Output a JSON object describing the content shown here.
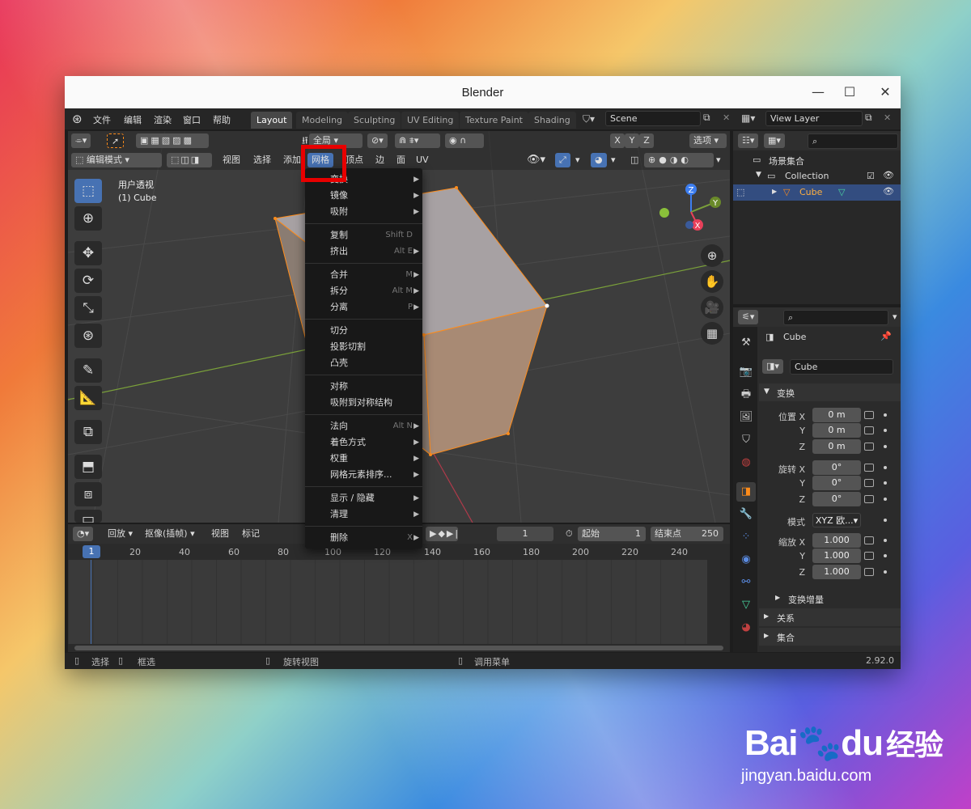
{
  "window": {
    "title": "Blender"
  },
  "topbar": {
    "menus": [
      "文件",
      "编辑",
      "渲染",
      "窗口",
      "帮助"
    ],
    "workspaces": [
      "Layout",
      "Modeling",
      "Sculpting",
      "UV Editing",
      "Texture Paint",
      "Shading"
    ],
    "scene": "Scene",
    "view_layer": "View Layer"
  },
  "viewport": {
    "transform_orient": "全局",
    "options": "选项",
    "axes": [
      "X",
      "Y",
      "Z"
    ],
    "mode": "编辑模式",
    "header_menus": {
      "view": "视图",
      "select": "选择",
      "add": "添加",
      "mesh": "网格",
      "vertex": "顶点",
      "edge": "边",
      "face": "面",
      "uv": "UV"
    },
    "overlay_title": "用户透视",
    "overlay_sub": "(1) Cube",
    "gizmo": {
      "x": "X",
      "y": "Y",
      "z": "Z"
    }
  },
  "mesh_menu": {
    "items": [
      {
        "label": "变换",
        "shortcut": "",
        "arrow": true
      },
      {
        "label": "镜像",
        "shortcut": "",
        "arrow": true
      },
      {
        "label": "吸附",
        "shortcut": "",
        "arrow": true
      },
      {
        "label": "复制",
        "shortcut": "Shift D",
        "arrow": false
      },
      {
        "label": "挤出",
        "shortcut": "Alt E",
        "arrow": true
      },
      {
        "label": "合并",
        "shortcut": "M",
        "arrow": true
      },
      {
        "label": "拆分",
        "shortcut": "Alt M",
        "arrow": true
      },
      {
        "label": "分离",
        "shortcut": "P",
        "arrow": true
      },
      {
        "label": "切分",
        "shortcut": "",
        "arrow": false
      },
      {
        "label": "投影切割",
        "shortcut": "",
        "arrow": false
      },
      {
        "label": "凸壳",
        "shortcut": "",
        "arrow": false
      },
      {
        "label": "对称",
        "shortcut": "",
        "arrow": false
      },
      {
        "label": "吸附到对称结构",
        "shortcut": "",
        "arrow": false
      },
      {
        "label": "法向",
        "shortcut": "Alt N",
        "arrow": true
      },
      {
        "label": "着色方式",
        "shortcut": "",
        "arrow": true
      },
      {
        "label": "权重",
        "shortcut": "",
        "arrow": true
      },
      {
        "label": "网格元素排序...",
        "shortcut": "",
        "arrow": true
      },
      {
        "label": "显示 / 隐藏",
        "shortcut": "",
        "arrow": true
      },
      {
        "label": "清理",
        "shortcut": "",
        "arrow": true
      },
      {
        "label": "删除",
        "shortcut": "X",
        "arrow": true
      }
    ]
  },
  "timeline": {
    "menus": {
      "playback": "回放",
      "keying": "抠像(插帧)",
      "view": "视图",
      "marker": "标记"
    },
    "current_frame": "1",
    "start_label": "起始",
    "start": "1",
    "end_label": "结束点",
    "end": "250",
    "ticks": [
      "1",
      "20",
      "40",
      "60",
      "80",
      "100",
      "120",
      "140",
      "160",
      "180",
      "200",
      "220",
      "240"
    ]
  },
  "status": {
    "select": "选择",
    "box_select": "框选",
    "rotate": "旋转视图",
    "call_menu": "调用菜单",
    "version": "2.92.0"
  },
  "outliner": {
    "scene_collection": "场景集合",
    "collection": "Collection",
    "object": "Cube"
  },
  "properties": {
    "object_name": "Cube",
    "data_name": "Cube",
    "transform_section": "变换",
    "location_label": "位置 X",
    "rotation_label": "旋转 X",
    "scale_label": "缩放 X",
    "y": "Y",
    "z": "Z",
    "location": [
      "0 m",
      "0 m",
      "0 m"
    ],
    "rotation": [
      "0°",
      "0°",
      "0°"
    ],
    "scale": [
      "1.000",
      "1.000",
      "1.000"
    ],
    "mode_label": "模式",
    "mode_value": "XYZ 欧...",
    "delta": "变换增量",
    "relations": "关系",
    "collections": "集合"
  },
  "watermark": {
    "brand": "Bai",
    "brand2": "du",
    "site_cn": "经验",
    "url": "jingyan.baidu.com"
  }
}
